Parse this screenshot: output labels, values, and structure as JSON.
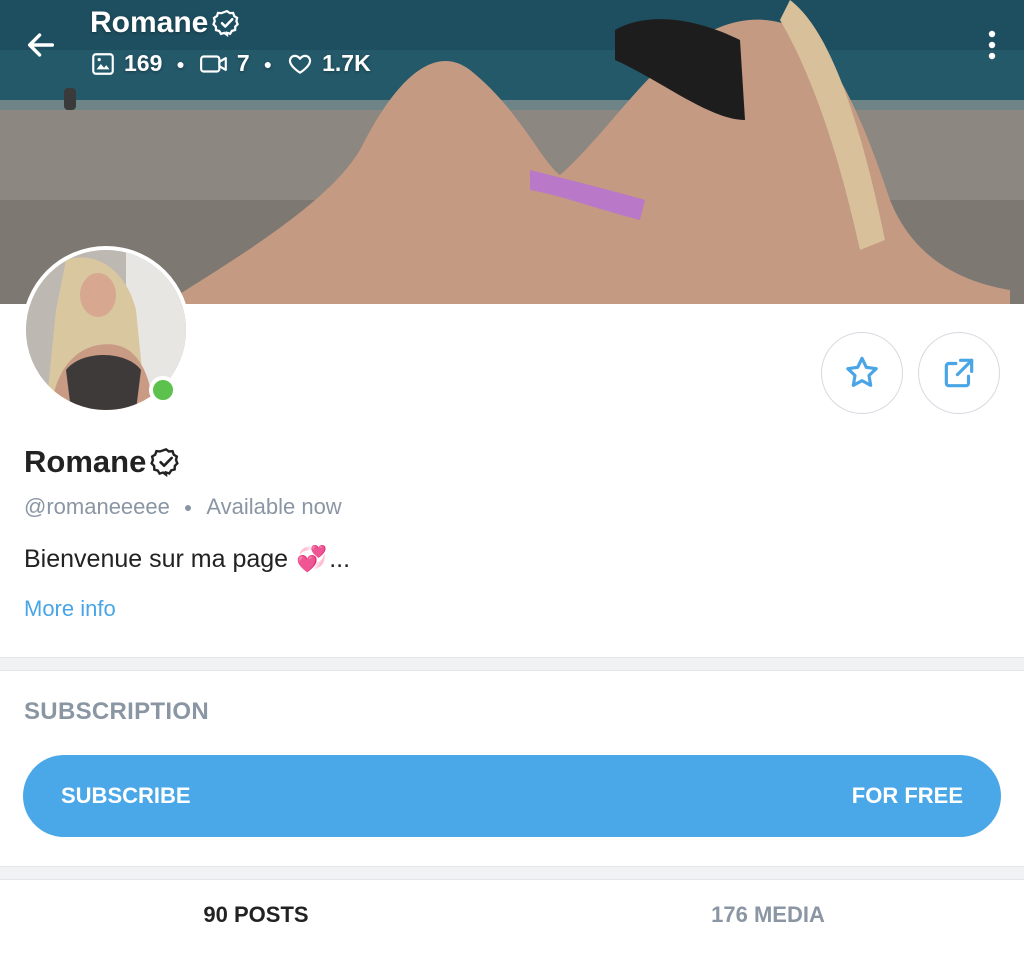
{
  "header": {
    "name": "Romane",
    "stats": {
      "photos": "169",
      "videos": "7",
      "likes": "1.7K"
    }
  },
  "profile": {
    "name": "Romane",
    "handle": "@romaneeeee",
    "status": "Available now",
    "bio": "Bienvenue sur ma page",
    "bio_emoji": "💞",
    "bio_ellipsis": "...",
    "more_info": "More info"
  },
  "subscription": {
    "title": "SUBSCRIPTION",
    "button_label": "SUBSCRIBE",
    "button_price": "FOR FREE"
  },
  "tabs": [
    {
      "label": "90 POSTS",
      "active": true
    },
    {
      "label": "176 MEDIA",
      "active": false
    }
  ],
  "colors": {
    "accent": "#4aa8e8",
    "online": "#5dc24d",
    "muted": "#8a96a3"
  },
  "icons": [
    "back-arrow-icon",
    "verified-badge-icon",
    "image-icon",
    "video-icon",
    "heart-icon",
    "more-vertical-icon",
    "star-icon",
    "share-icon"
  ]
}
